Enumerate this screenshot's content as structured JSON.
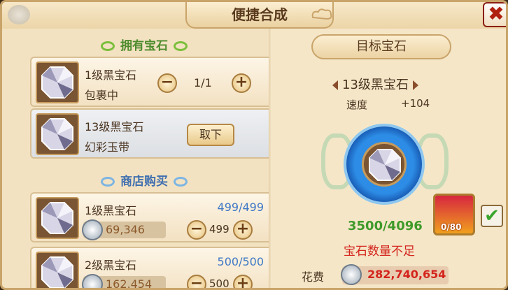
{
  "window": {
    "title": "便捷合成",
    "close_label": "✖"
  },
  "owned": {
    "header": "拥有宝石",
    "items": [
      {
        "name": "1级黑宝石",
        "location": "包裹中",
        "quantity": "1/1",
        "minus": "−",
        "plus": "+"
      },
      {
        "name": "13级黑宝石",
        "location": "幻彩玉带",
        "action_label": "取下"
      }
    ]
  },
  "shop": {
    "header": "商店购买",
    "items": [
      {
        "name": "1级黑宝石",
        "stock": "499/499",
        "price": "69,346",
        "buy_qty": "499",
        "minus": "−",
        "plus": "+"
      },
      {
        "name": "2级黑宝石",
        "stock": "500/500",
        "price": "162,454",
        "buy_qty": "500",
        "minus": "−",
        "plus": "+"
      }
    ]
  },
  "target": {
    "header": "目标宝石",
    "name": "13级黑宝石",
    "stat_label": "速度",
    "stat_value": "+104",
    "progress": "3500/4096",
    "warning": "宝石数量不足",
    "chest_count": "0/80",
    "checkbox_mark": "✔",
    "cost_label": "花费",
    "cost_value": "282,740,654"
  },
  "colors": {
    "accent_green": "#3f9a2a",
    "warning_red": "#d4241c",
    "stock_blue": "#3f78c6",
    "ring_blue": "#2d8de6"
  }
}
